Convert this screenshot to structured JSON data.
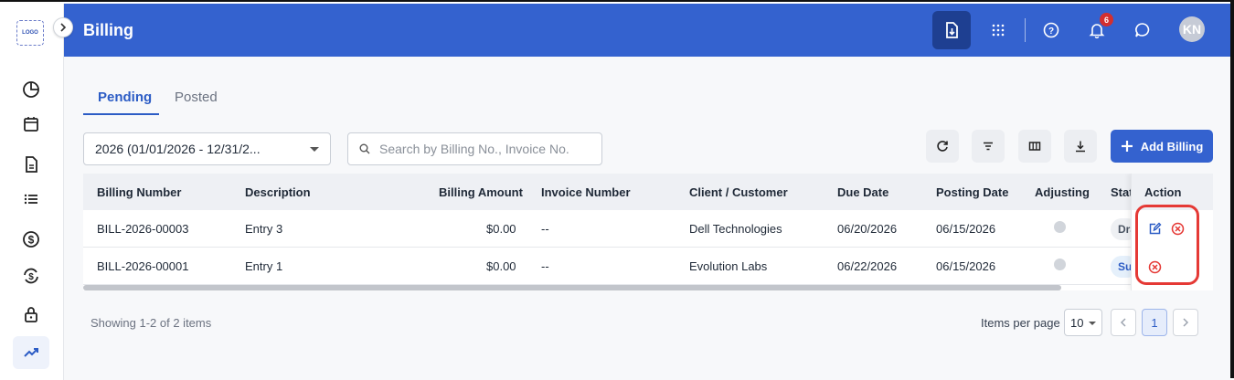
{
  "app": {
    "logo_text": "LOGO",
    "title": "Billing"
  },
  "header": {
    "notification_count": "6",
    "avatar_initials": "KN"
  },
  "tabs": [
    {
      "label": "Pending",
      "active": true
    },
    {
      "label": "Posted",
      "active": false
    }
  ],
  "filters": {
    "year_selected": "2026 (01/01/2026 - 12/31/2...",
    "search_placeholder": "Search by Billing No., Invoice No."
  },
  "toolbar": {
    "add_label": "Add Billing"
  },
  "table": {
    "columns": [
      "Billing Number",
      "Description",
      "Billing Amount",
      "Invoice Number",
      "Client / Customer",
      "Due Date",
      "Posting Date",
      "Adjusting",
      "Status",
      "Action"
    ],
    "rows": [
      {
        "billing_number": "BILL-2026-00003",
        "description": "Entry 3",
        "amount": "$0.00",
        "invoice": "--",
        "client": "Dell Technologies",
        "due": "06/20/2026",
        "posting": "06/15/2026",
        "status": "Draft"
      },
      {
        "billing_number": "BILL-2026-00001",
        "description": "Entry 1",
        "amount": "$0.00",
        "invoice": "--",
        "client": "Evolution Labs",
        "due": "06/22/2026",
        "posting": "06/15/2026",
        "status": "Submitted"
      }
    ]
  },
  "footer": {
    "showing": "Showing 1-2 of 2 items",
    "items_per_page_label": "Items per page",
    "items_per_page_value": "10",
    "current_page": "1"
  },
  "colors": {
    "brand": "#3462cf",
    "accent_dark": "#1e3f91",
    "danger": "#e53935"
  }
}
